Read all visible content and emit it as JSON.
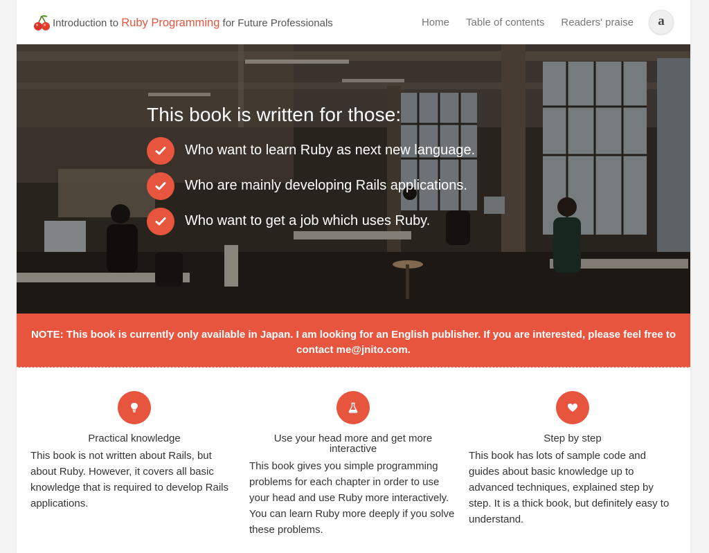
{
  "header": {
    "title_prefix": "Introduction to ",
    "title_accent": "Ruby Programming",
    "title_suffix": " for Future Professionals",
    "logo_icon": "cherry-icon",
    "nav": [
      {
        "label": "Home"
      },
      {
        "label": "Table of contents"
      },
      {
        "label": "Readers' praise"
      }
    ],
    "amazon_label": "a",
    "amazon_icon": "amazon-icon"
  },
  "hero": {
    "heading": "This book is written for those:",
    "items": [
      {
        "text": "Who want to learn Ruby as next new language.",
        "icon": "check-icon"
      },
      {
        "text": "Who are mainly developing Rails applications.",
        "icon": "check-icon"
      },
      {
        "text": "Who want to get a job which uses Ruby.",
        "icon": "check-icon"
      }
    ]
  },
  "notice": {
    "text": "NOTE: This book is currently only available in Japan. I am looking for an English publisher. If you are interested, please feel free to contact me@jnito.com."
  },
  "features": [
    {
      "icon": "lightbulb-icon",
      "title": "Practical knowledge",
      "body": "This book is not written about Rails, but about Ruby. However, it covers all basic knowledge that is required to develop Rails applications."
    },
    {
      "icon": "flask-icon",
      "title": "Use your head more and get more interactive",
      "body": "This book gives you simple programming problems for each chapter in order to use your head and use Ruby more interactively. You can learn Ruby more deeply if you solve these problems."
    },
    {
      "icon": "heart-icon",
      "title": "Step by step",
      "body": "This book has lots of sample code and guides about basic knowledge up to advanced techniques, explained step by step. It is a thick book, but definitely easy to understand."
    }
  ],
  "colors": {
    "accent": "#e7553f",
    "text": "#333333",
    "nav": "#777777"
  }
}
